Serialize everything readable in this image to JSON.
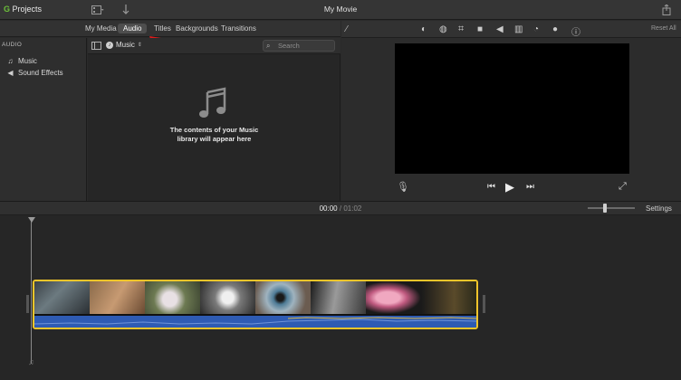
{
  "titlebar": {
    "back_label_green": "G",
    "back_label": "Projects",
    "title": "My Movie"
  },
  "tabs": [
    {
      "label": "My Media"
    },
    {
      "label": "Audio"
    },
    {
      "label": "Titles"
    },
    {
      "label": "Backgrounds"
    },
    {
      "label": "Transitions"
    }
  ],
  "sidebar": {
    "header": "AUDIO",
    "items": [
      {
        "label": "Music",
        "icon": "music-note-icon"
      },
      {
        "label": "Sound Effects",
        "icon": "speaker-icon"
      }
    ]
  },
  "browser": {
    "source_label": "Music",
    "search_placeholder": "Search",
    "empty_line1": "The contents of your Music",
    "empty_line2": "library will appear here"
  },
  "viewer": {
    "reset_label": "Reset All"
  },
  "timeline": {
    "current_time": "00:00",
    "separator": "/",
    "duration": "01:02",
    "settings_label": "Settings"
  },
  "colors": {
    "accent_clip_border": "#f0c52a",
    "audio_wave": "#2e5bb3",
    "annotation_arrow": "#e01b1b"
  }
}
